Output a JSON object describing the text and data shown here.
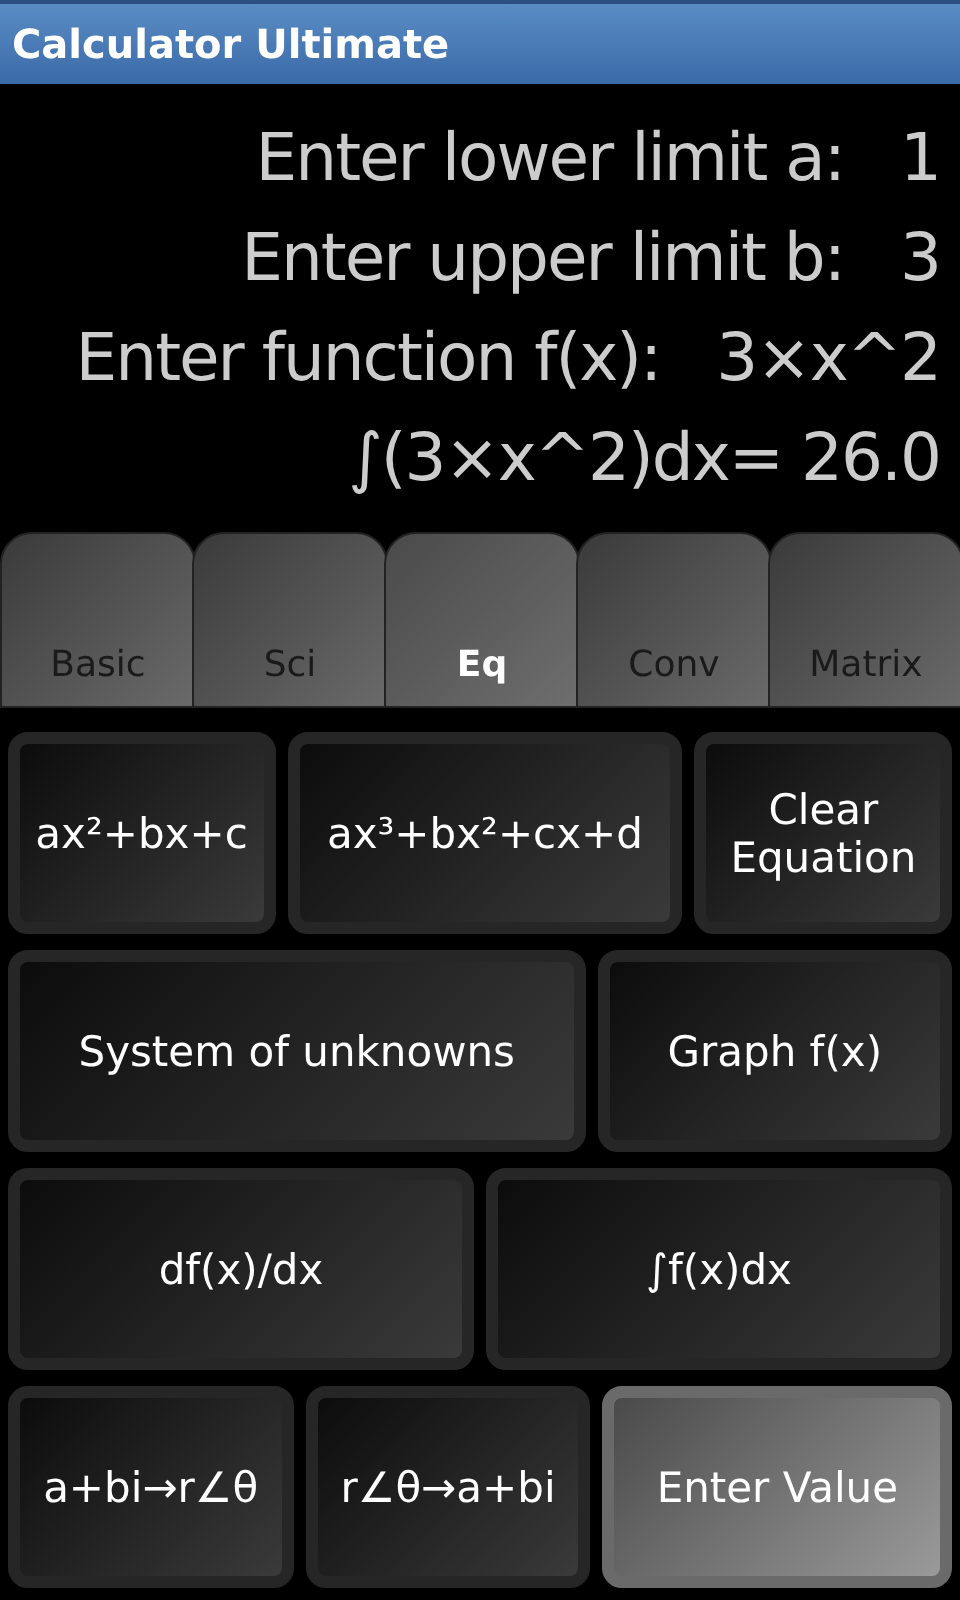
{
  "window": {
    "title": "Calculator Ultimate"
  },
  "display": {
    "lines": [
      {
        "label": "Enter lower limit a:",
        "value": "1"
      },
      {
        "label": "Enter upper limit b:",
        "value": "3"
      },
      {
        "label": "Enter function f(x):",
        "value": "3×x^2"
      }
    ],
    "result": "∫(3×x^2)dx= 26.0"
  },
  "tabs": [
    {
      "label": "Basic",
      "selected": false
    },
    {
      "label": "Sci",
      "selected": false
    },
    {
      "label": "Eq",
      "selected": true
    },
    {
      "label": "Conv",
      "selected": false
    },
    {
      "label": "Matrix",
      "selected": false
    }
  ],
  "keypad": [
    {
      "keys": [
        {
          "label": "ax²+bx+c",
          "kind": "dark"
        },
        {
          "label": "ax³+bx²+cx+d",
          "kind": "dark"
        },
        {
          "label": "Clear Equation",
          "kind": "dark"
        }
      ]
    },
    {
      "keys": [
        {
          "label": "System of unknowns",
          "kind": "dark"
        },
        {
          "label": "Graph f(x)",
          "kind": "dark"
        }
      ]
    },
    {
      "keys": [
        {
          "label": "df(x)/dx",
          "kind": "dark"
        },
        {
          "label": "∫f(x)dx",
          "kind": "dark"
        }
      ]
    },
    {
      "keys": [
        {
          "label": "a+bi→r∠θ",
          "kind": "dark"
        },
        {
          "label": "r∠θ→a+bi",
          "kind": "dark"
        },
        {
          "label": "Enter Value",
          "kind": "light"
        }
      ]
    }
  ]
}
